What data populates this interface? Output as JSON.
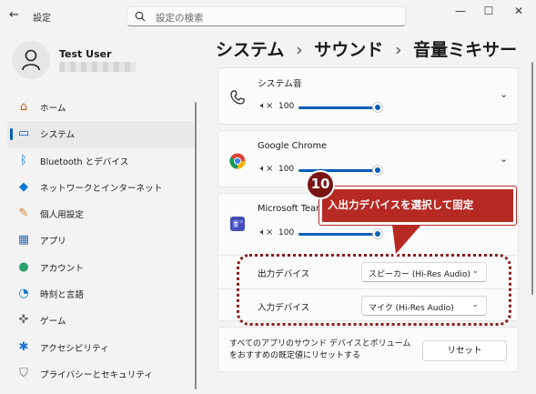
{
  "window": {
    "back": "←",
    "title": "設定",
    "minimize": "—",
    "maximize": "☐",
    "close": "✕"
  },
  "search": {
    "placeholder": "設定の検索"
  },
  "user": {
    "name": "Test User"
  },
  "nav": [
    {
      "label": "ホーム",
      "icon": "home-icon",
      "glyph": "⌂"
    },
    {
      "label": "システム",
      "icon": "monitor-icon",
      "glyph": "▭"
    },
    {
      "label": "Bluetooth とデバイス",
      "icon": "bluetooth-icon",
      "glyph": "ᛒ"
    },
    {
      "label": "ネットワークとインターネット",
      "icon": "wifi-icon",
      "glyph": "◆"
    },
    {
      "label": "個人用設定",
      "icon": "brush-icon",
      "glyph": "✎"
    },
    {
      "label": "アプリ",
      "icon": "apps-icon",
      "glyph": "▦"
    },
    {
      "label": "アカウント",
      "icon": "account-icon",
      "glyph": "●"
    },
    {
      "label": "時刻と言語",
      "icon": "clock-globe-icon",
      "glyph": "◔"
    },
    {
      "label": "ゲーム",
      "icon": "gamepad-icon",
      "glyph": "✜"
    },
    {
      "label": "アクセシビリティ",
      "icon": "accessibility-icon",
      "glyph": "✱"
    },
    {
      "label": "プライバシーとセキュリティ",
      "icon": "shield-icon",
      "glyph": "⛉"
    }
  ],
  "breadcrumb": [
    "システム",
    "›",
    "サウンド",
    "›",
    "音量ミキサー"
  ],
  "apps": [
    {
      "name": "システム音",
      "icon": "phone-icon",
      "volume": 100,
      "volume_fraction": 1.0
    },
    {
      "name": "Google Chrome",
      "icon": "chrome-icon",
      "volume": 100,
      "volume_fraction": 1.0
    },
    {
      "name": "Microsoft Teams",
      "icon": "teams-icon",
      "volume": 100,
      "volume_fraction": 1.0
    }
  ],
  "speaker_glyph": "🔈︎×",
  "chevron": "⌄",
  "devices": {
    "output_label": "出力デバイス",
    "output_value": "スピーカー (Hi-Res Audio)",
    "input_label": "入力デバイス",
    "input_value": "マイク (Hi-Res Audio)"
  },
  "reset": {
    "description": "すべてのアプリのサウンド デバイスとボリュームをおすすめの既定値にリセットする",
    "button": "リセット"
  },
  "annotation": {
    "step": "10",
    "text": "入出力デバイスを選択して固定"
  },
  "colors": {
    "accent": "#005fb8",
    "annotation": "#b72a24",
    "annotation_border": "#8b1d1d"
  }
}
